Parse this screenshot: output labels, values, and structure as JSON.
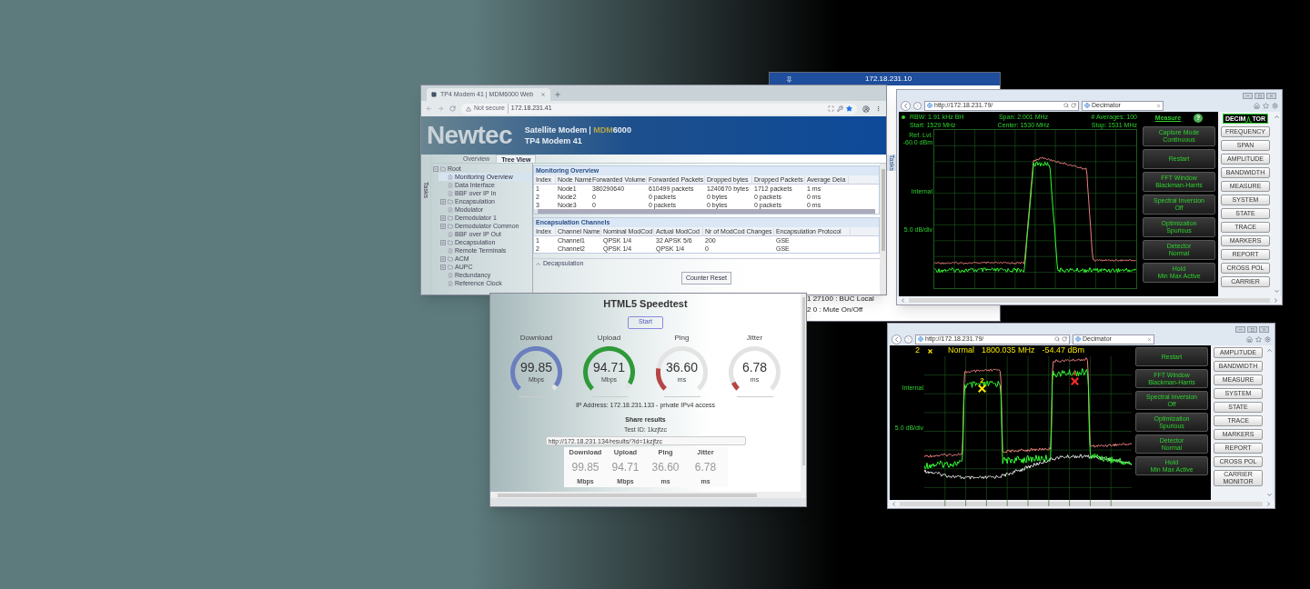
{
  "background_window": {
    "title": "172.18.231.10",
    "side_label": "Tasks",
    "lines": [
      "1 27100 : BUC Local",
      "2 0 : Mute On/Off"
    ]
  },
  "modem_window": {
    "tab_title": "TP4 Modem 41 | MDM6000 Web",
    "security": "Not secure",
    "address": "172.18.231.41",
    "logo": "Newtec",
    "product": "Satellite Modem",
    "model_prefix": "MDM",
    "model_suffix": "6000",
    "device": "TP4 Modem 41",
    "side_label": "Tasks",
    "view_tabs": [
      {
        "label": "Overview",
        "selected": false
      },
      {
        "label": "Tree View",
        "selected": true
      }
    ],
    "tree": [
      {
        "label": "Root",
        "kind": "folder",
        "expanded": true,
        "selected": false,
        "children": [
          {
            "label": "Monitoring Overview",
            "kind": "leaf",
            "selected": true
          },
          {
            "label": "Data Interface",
            "kind": "leaf",
            "selected": false
          },
          {
            "label": "BBF over IP In",
            "kind": "leaf",
            "selected": false
          },
          {
            "label": "Encapsulation",
            "kind": "folder",
            "expanded": false,
            "selected": false
          },
          {
            "label": "Modulator",
            "kind": "leaf",
            "selected": false
          },
          {
            "label": "Demodulator 1",
            "kind": "folder",
            "expanded": false,
            "selected": false
          },
          {
            "label": "Demodulator Common",
            "kind": "folder",
            "expanded": false,
            "selected": false
          },
          {
            "label": "BBF over IP Out",
            "kind": "leaf",
            "selected": false
          },
          {
            "label": "Decapsulation",
            "kind": "folder",
            "expanded": false,
            "selected": false
          },
          {
            "label": "Remote Terminals",
            "kind": "leaf",
            "selected": false
          },
          {
            "label": "ACM",
            "kind": "folder",
            "expanded": false,
            "selected": false
          },
          {
            "label": "AUPC",
            "kind": "folder",
            "expanded": false,
            "selected": false
          },
          {
            "label": "Redundancy",
            "kind": "leaf",
            "selected": false
          },
          {
            "label": "Reference Clock",
            "kind": "leaf",
            "selected": false
          }
        ]
      }
    ],
    "monitoring": {
      "title": "Monitoring Overview",
      "columns": [
        "Index",
        "Node Name",
        "Forwarded Volume",
        "Forwarded Packets",
        "Dropped bytes",
        "Dropped Packets",
        "Average Dela"
      ],
      "rows": [
        [
          "1",
          "Node1",
          "380290640",
          "610499 packets",
          "1240670 bytes",
          "1712 packets",
          "1 ms"
        ],
        [
          "2",
          "Node2",
          "0",
          "0 packets",
          "0 bytes",
          "0 packets",
          "0 ms"
        ],
        [
          "3",
          "Node3",
          "0",
          "0 packets",
          "0 bytes",
          "0 packets",
          "0 ms"
        ]
      ]
    },
    "encapsulation": {
      "title": "Encapsulation Channels",
      "columns": [
        "Index",
        "Channel Name",
        "Nominal ModCod",
        "Actual ModCod",
        "Nr of ModCod Changes",
        "Encapsulation Protocol"
      ],
      "rows": [
        [
          "1",
          "Channel1",
          "QPSK 1/4",
          "32 APSK 5/6",
          "200",
          "GSE"
        ],
        [
          "2",
          "Channel2",
          "QPSK 1/4",
          "QPSK 1/4",
          "0",
          "GSE"
        ]
      ]
    },
    "decapsulation": {
      "label": "Decapsulation",
      "expanded": false
    },
    "counter_reset": "Counter Reset"
  },
  "speedtest_window": {
    "title": "HTML5 Speedtest",
    "start": "Start",
    "gauges": [
      {
        "label": "Download",
        "value": "99.85",
        "unit": "Mbps",
        "level": 0.96,
        "color": "#6a7fbd"
      },
      {
        "label": "Upload",
        "value": "94.71",
        "unit": "Mbps",
        "level": 0.94,
        "color": "#2f9a3a"
      },
      {
        "label": "Ping",
        "value": "36.60",
        "unit": "ms",
        "level": 0.2,
        "color": "#b54646"
      },
      {
        "label": "Jitter",
        "value": "6.78",
        "unit": "ms",
        "level": 0.07,
        "color": "#b54646"
      }
    ],
    "ip": "IP Address: 172.18.231.133 - private IPv4 access",
    "share_title": "Share results",
    "test_id": "Test ID: 1kzjfzc",
    "share_url": "http://172.18.231.134/results/?id=1kzjfzc",
    "results": [
      {
        "label": "Download",
        "value": "99.85",
        "unit": "Mbps"
      },
      {
        "label": "Upload",
        "value": "94.71",
        "unit": "Mbps"
      },
      {
        "label": "Ping",
        "value": "36.60",
        "unit": "ms"
      },
      {
        "label": "Jitter",
        "value": "6.78",
        "unit": "ms"
      }
    ]
  },
  "analyzer_window_1": {
    "url": "http://172.18.231.79/",
    "tab": "Decimator",
    "readouts": [
      "RBW: 1.91 kHz BH",
      "Span: 2.001 MHz",
      "# Averages: 100",
      "Start: 1529 MHz",
      "Center: 1530 MHz",
      "Stop: 1531 MHz"
    ],
    "axis_labels": [
      "Ref. Lvl.",
      "-60.0 dBm",
      "Internal",
      "5.0 dB/div"
    ],
    "menu_title": "Measure",
    "help": "?",
    "logo_left": "DECIM",
    "logo_right": "TOR",
    "functions": [
      {
        "title": "Capture Mode",
        "value": "Continuous"
      },
      {
        "title": "Restart"
      },
      {
        "title": "FFT Window",
        "value": "Blackman-Harris"
      },
      {
        "title": "Spectral Inversion",
        "value": "Off"
      },
      {
        "title": "Optimization",
        "value": "Spurious"
      },
      {
        "title": "Detector",
        "value": "Normal"
      },
      {
        "title": "Hold",
        "value": "Min Max Active"
      }
    ],
    "nav": [
      "FREQUENCY",
      "SPAN",
      "AMPLITUDE",
      "BANDWIDTH",
      "MEASURE",
      "SYSTEM",
      "STATE",
      "TRACE",
      "MARKERS",
      "REPORT",
      "CROSS POL",
      "CARRIER"
    ]
  },
  "analyzer_window_2": {
    "url": "http://172.18.231.79/",
    "tab": "Decimator",
    "marker_readout": {
      "number": "2",
      "mode": "Normal",
      "frequency": "1800.035 MHz",
      "level": "-54.47 dBm"
    },
    "axis_labels": [
      "Internal",
      "5.0 dB/div"
    ],
    "markers": [
      {
        "label": "2",
        "color": "#f2e600"
      },
      {
        "label": "1",
        "color": "#ff2a2a"
      }
    ],
    "functions": [
      {
        "title": "Restart"
      },
      {
        "title": "FFT Window",
        "value": "Blackman-Harris"
      },
      {
        "title": "Spectral Inversion",
        "value": "Off"
      },
      {
        "title": "Optimization",
        "value": "Spurious"
      },
      {
        "title": "Detector",
        "value": "Normal"
      },
      {
        "title": "Hold",
        "value": "Min Max Active"
      }
    ],
    "nav": [
      "AMPLITUDE",
      "BANDWIDTH",
      "MEASURE",
      "SYSTEM",
      "STATE",
      "TRACE",
      "MARKERS",
      "REPORT",
      "CROSS POL",
      "CARRIER MONITOR"
    ]
  }
}
